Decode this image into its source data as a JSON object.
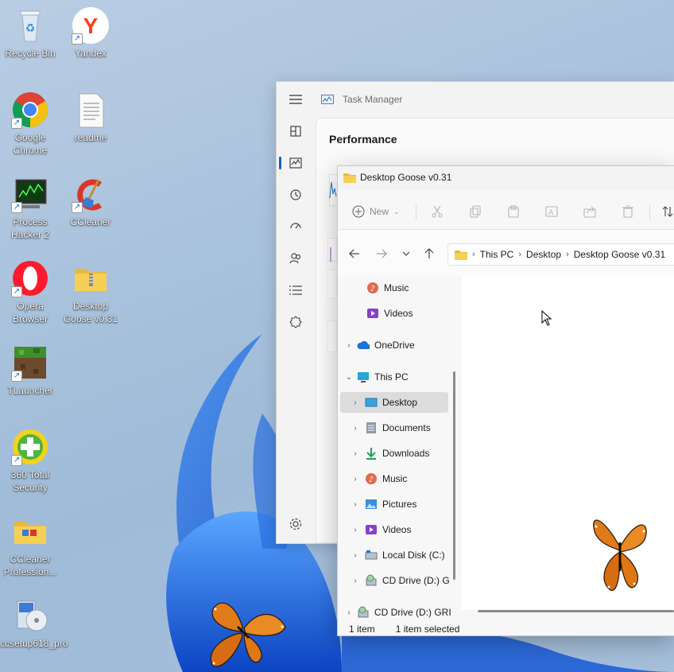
{
  "desktop": {
    "icons": [
      {
        "label": "Recycle Bin",
        "icon": "recycle-bin-icon",
        "shortcut": false
      },
      {
        "label": "Yandex",
        "icon": "yandex-icon",
        "shortcut": true
      },
      {
        "label": "Google Chrome",
        "icon": "chrome-icon",
        "shortcut": true
      },
      {
        "label": "readme",
        "icon": "text-document-icon",
        "shortcut": false
      },
      {
        "label": "Process Hacker 2",
        "icon": "process-hacker-icon",
        "shortcut": true
      },
      {
        "label": "CCleaner",
        "icon": "ccleaner-icon",
        "shortcut": true
      },
      {
        "label": "Opera Browser",
        "icon": "opera-icon",
        "shortcut": true
      },
      {
        "label": "Desktop Goose v0.31",
        "icon": "zip-folder-icon",
        "shortcut": false
      },
      {
        "label": "TLauncher",
        "icon": "tlauncher-icon",
        "shortcut": true
      },
      {
        "label": "360 Total Security",
        "icon": "360-security-icon",
        "shortcut": true
      },
      {
        "label": "CCleaner Profession...",
        "icon": "folder-icon",
        "shortcut": false
      },
      {
        "label": "ccsetup618_pro",
        "icon": "installer-icon",
        "shortcut": false
      }
    ]
  },
  "task_manager": {
    "title": "Task Manager",
    "section": "Performance",
    "rail_icons": [
      "hamburger-menu-icon",
      "processes-icon",
      "performance-icon",
      "app-history-icon",
      "startup-apps-icon",
      "users-icon",
      "details-icon",
      "services-icon",
      "settings-icon"
    ]
  },
  "explorer": {
    "title": "Desktop Goose v0.31",
    "toolbar": {
      "new_label": "New"
    },
    "breadcrumb": [
      "This PC",
      "Desktop",
      "Desktop Goose v0.31"
    ],
    "tree": [
      {
        "label": "Music",
        "icon": "music-icon",
        "indent": 1,
        "chevron": ""
      },
      {
        "label": "Videos",
        "icon": "videos-icon",
        "indent": 1,
        "chevron": ""
      },
      {
        "label": "OneDrive",
        "icon": "onedrive-icon",
        "indent": 0,
        "chevron": "›"
      },
      {
        "label": "This PC",
        "icon": "this-pc-icon",
        "indent": 0,
        "chevron": "⌄"
      },
      {
        "label": "Desktop",
        "icon": "desktop-icon",
        "indent": 1,
        "chevron": "›",
        "selected": true
      },
      {
        "label": "Documents",
        "icon": "documents-icon",
        "indent": 1,
        "chevron": "›"
      },
      {
        "label": "Downloads",
        "icon": "downloads-icon",
        "indent": 1,
        "chevron": "›"
      },
      {
        "label": "Music",
        "icon": "music-icon",
        "indent": 1,
        "chevron": "›"
      },
      {
        "label": "Pictures",
        "icon": "pictures-icon",
        "indent": 1,
        "chevron": "›"
      },
      {
        "label": "Videos",
        "icon": "videos-icon",
        "indent": 1,
        "chevron": "›"
      },
      {
        "label": "Local Disk (C:)",
        "icon": "local-disk-icon",
        "indent": 1,
        "chevron": "›"
      },
      {
        "label": "CD Drive (D:) G",
        "icon": "cd-drive-icon",
        "indent": 1,
        "chevron": "›"
      },
      {
        "label": "CD Drive (D:) GRI",
        "icon": "cd-drive-icon",
        "indent": 0,
        "chevron": "›"
      }
    ],
    "status": {
      "items": "1 item",
      "selected": "1 item selected"
    }
  },
  "colors": {
    "accent": "#0067c0",
    "selection": "#dcdcdc",
    "butterfly": "#e07b1a"
  }
}
